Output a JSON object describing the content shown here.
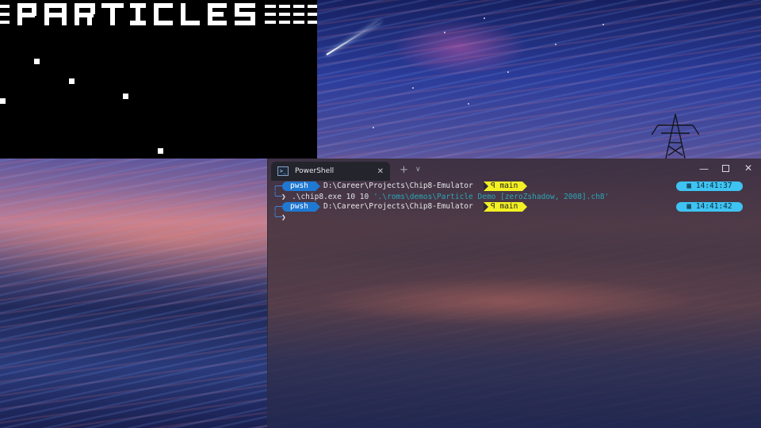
{
  "particles_window": {
    "title_glyph_text": "PARTICLES"
  },
  "terminal": {
    "tab": {
      "icon_name": "powershell-icon",
      "label": "PowerShell",
      "close_glyph": "✕"
    },
    "new_tab_glyph": "+",
    "dropdown_glyph": "∨",
    "window_controls": {
      "minimize": "—",
      "close": "✕"
    },
    "lines": [
      {
        "shell": "pwsh",
        "path": "D:\\Career\\Projects\\Chip8-Emulator",
        "branch_icon": "ꟼ",
        "branch": "main",
        "time_icon": "▦",
        "time": "14:41:37"
      },
      {
        "command_exe": ".\\chip8.exe 10 10 ",
        "command_arg": "'.\\roms\\demos\\Particle Demo [zeroZshadow, 2008].ch8'"
      },
      {
        "shell": "pwsh",
        "path": "D:\\Career\\Projects\\Chip8-Emulator",
        "branch_icon": "ꟼ",
        "branch": "main",
        "time_icon": "▦",
        "time": "14:41:42"
      }
    ],
    "prompt_glyph": "❯",
    "corner_top": "╭─",
    "corner_bottom": "╰─",
    "accent_colors": {
      "pwsh_segment": "#1f78d1",
      "branch_segment": "#f3f024",
      "time_segment": "#3ec3f2",
      "string_argument": "#2aa7b7"
    }
  }
}
